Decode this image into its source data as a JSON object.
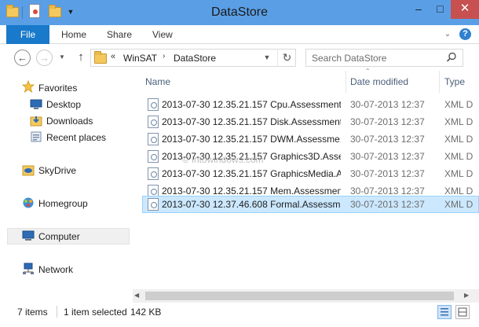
{
  "window": {
    "title": "DataStore",
    "controls": {
      "minimize": "–",
      "maximize": "□",
      "close": "✕"
    }
  },
  "ribbon": {
    "tabs": [
      "File",
      "Home",
      "Share",
      "View"
    ]
  },
  "address": {
    "overflow": "«",
    "crumbs": [
      "WinSAT",
      "DataStore"
    ],
    "separator": "›"
  },
  "search": {
    "placeholder": "Search DataStore"
  },
  "nav": {
    "items": [
      {
        "label": "Favorites",
        "icon": "star-icon"
      },
      {
        "label": "Desktop",
        "icon": "desktop-icon"
      },
      {
        "label": "Downloads",
        "icon": "downloads-icon"
      },
      {
        "label": "Recent places",
        "icon": "recent-places-icon"
      },
      {
        "label": "SkyDrive",
        "icon": "skydrive-icon"
      },
      {
        "label": "Homegroup",
        "icon": "homegroup-icon"
      },
      {
        "label": "Computer",
        "icon": "computer-icon"
      },
      {
        "label": "Network",
        "icon": "network-icon"
      }
    ]
  },
  "columns": {
    "name": "Name",
    "date": "Date modified",
    "type": "Type"
  },
  "files": [
    {
      "name": "2013-07-30 12.35.21.157 Cpu.Assessment ...",
      "date": "30-07-2013 12:37",
      "type": "XML D"
    },
    {
      "name": "2013-07-30 12.35.21.157 Disk.Assessment ...",
      "date": "30-07-2013 12:37",
      "type": "XML D"
    },
    {
      "name": "2013-07-30 12.35.21.157 DWM.Assessme...",
      "date": "30-07-2013 12:37",
      "type": "XML D"
    },
    {
      "name": "2013-07-30 12.35.21.157 Graphics3D.Asse...",
      "date": "30-07-2013 12:37",
      "type": "XML D"
    },
    {
      "name": "2013-07-30 12.35.21.157 GraphicsMedia.A...",
      "date": "30-07-2013 12:37",
      "type": "XML D"
    },
    {
      "name": "2013-07-30 12.35.21.157 Mem.Assessmen...",
      "date": "30-07-2013 12:37",
      "type": "XML D"
    },
    {
      "name": "2013-07-30 12.37.46.608 Formal.Assessm...",
      "date": "30-07-2013 12:37",
      "type": "XML D",
      "selected": true
    }
  ],
  "watermark": "© intowindows.com",
  "status": {
    "count": "7 items",
    "selection": "1 item selected",
    "size": "142 KB"
  },
  "colors": {
    "titlebar": "#5a9fe6",
    "file_tab": "#1979ca",
    "close_button": "#c75050",
    "selection": "#cce8ff"
  }
}
